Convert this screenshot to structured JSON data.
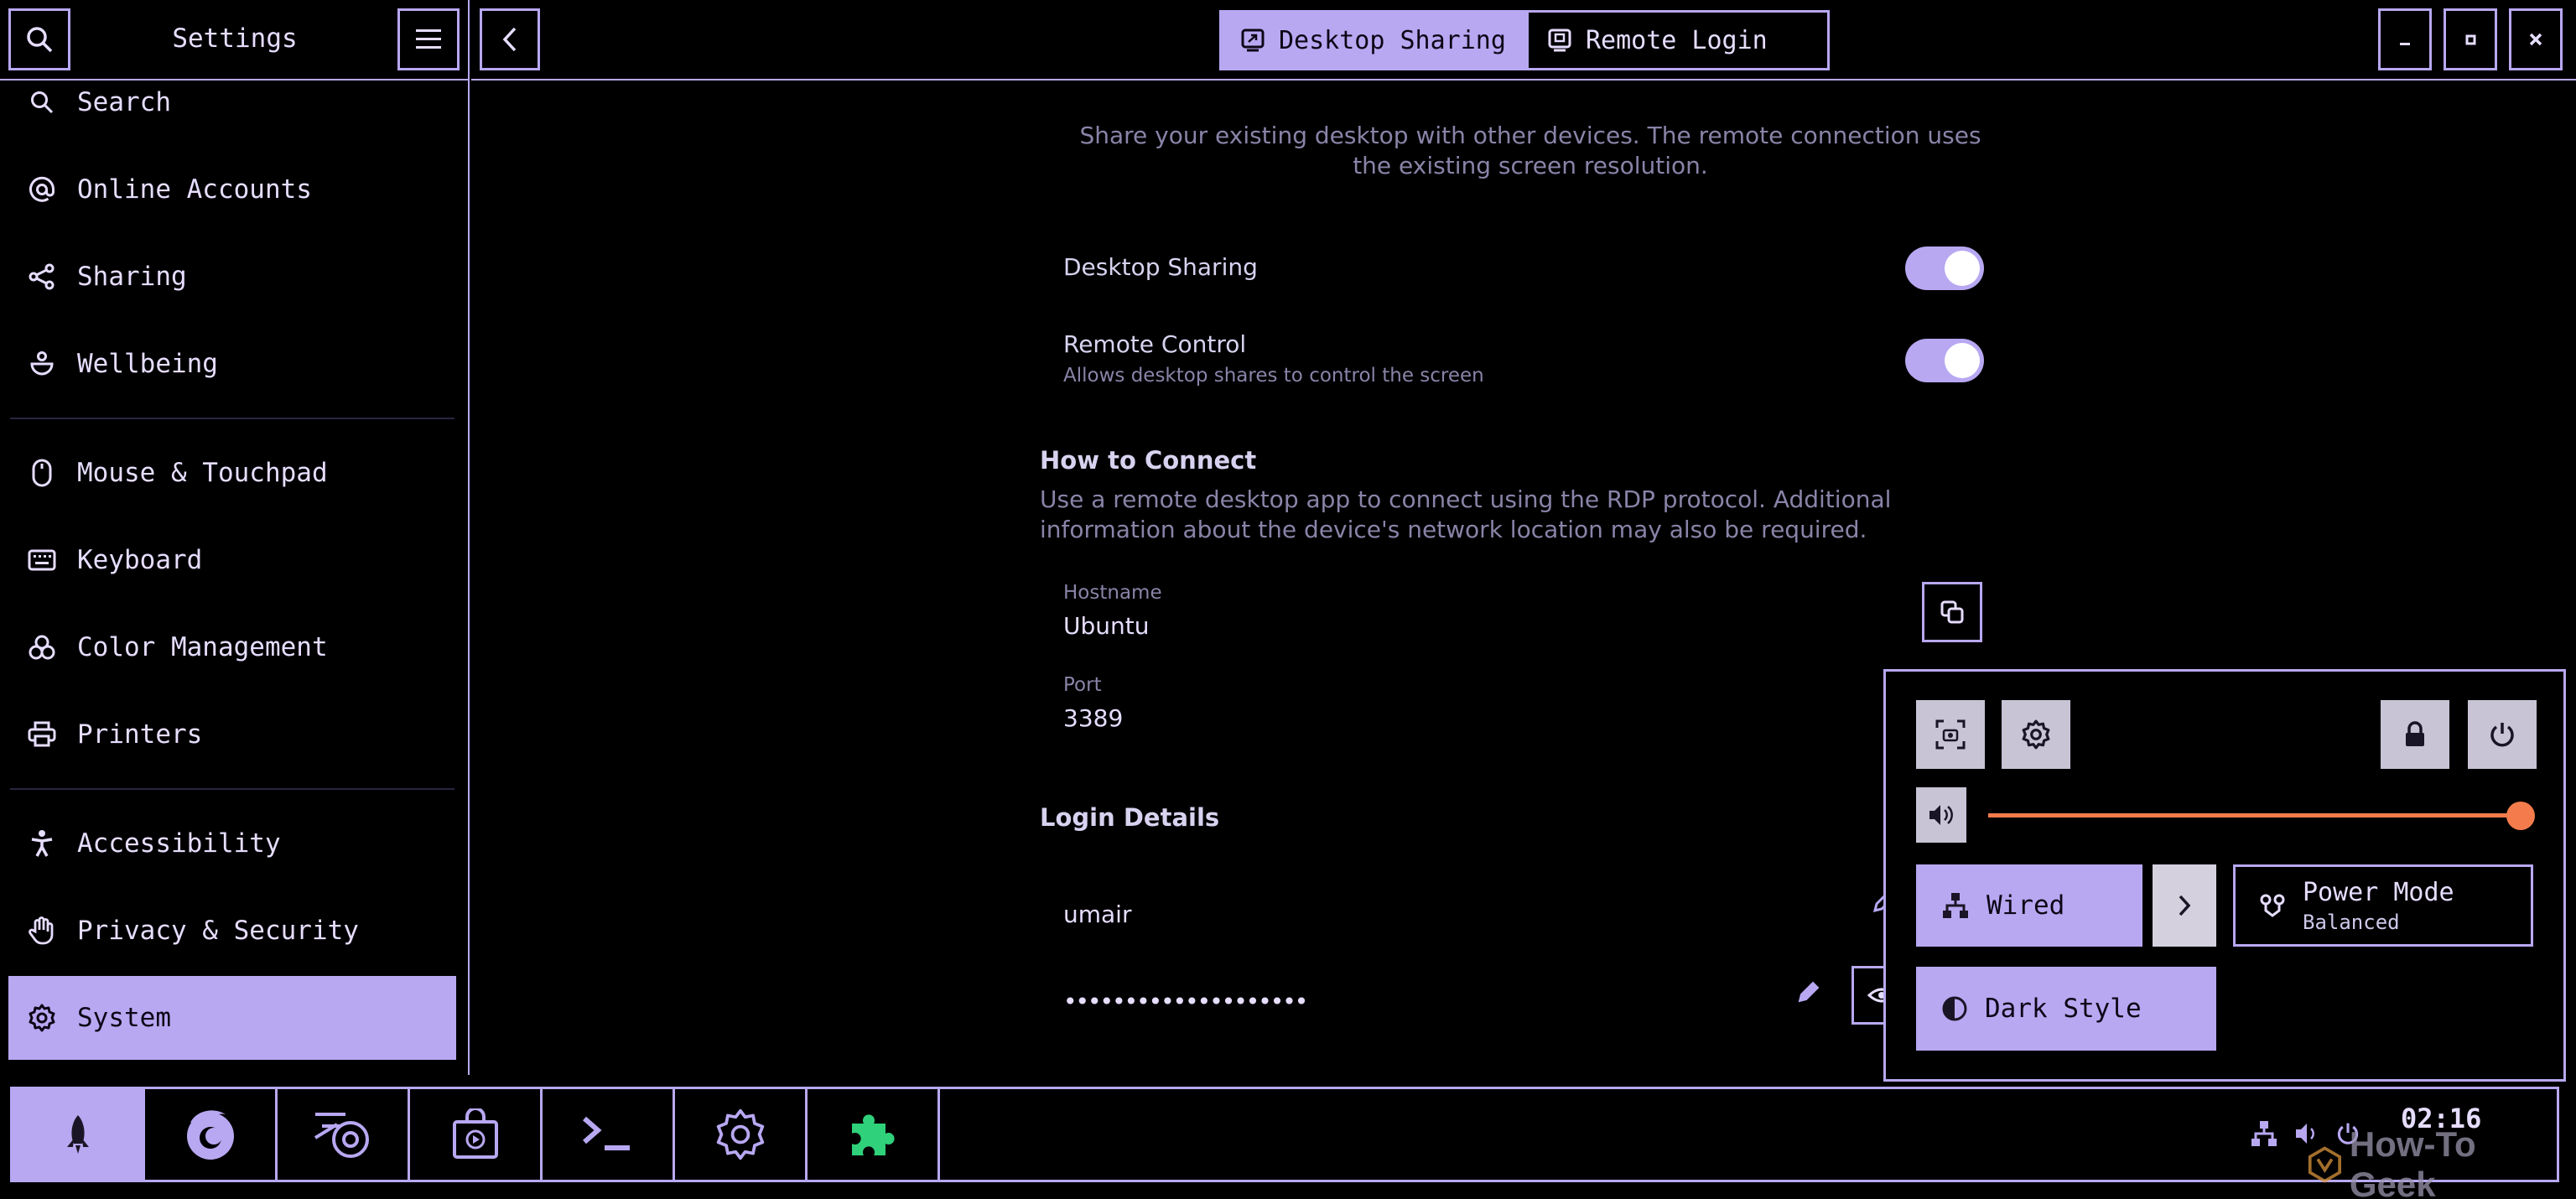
{
  "sidebar": {
    "title": "Settings",
    "items": [
      {
        "label": "Search",
        "icon": "search-icon"
      },
      {
        "label": "Online Accounts",
        "icon": "at-icon"
      },
      {
        "label": "Sharing",
        "icon": "share-icon"
      },
      {
        "label": "Wellbeing",
        "icon": "wellbeing-icon"
      },
      {
        "label": "Mouse & Touchpad",
        "icon": "mouse-icon"
      },
      {
        "label": "Keyboard",
        "icon": "keyboard-icon"
      },
      {
        "label": "Color Management",
        "icon": "color-icon"
      },
      {
        "label": "Printers",
        "icon": "printer-icon"
      },
      {
        "label": "Accessibility",
        "icon": "accessibility-icon"
      },
      {
        "label": "Privacy & Security",
        "icon": "hand-icon"
      },
      {
        "label": "System",
        "icon": "gear-icon"
      }
    ],
    "active": "System"
  },
  "header": {
    "tabs": [
      {
        "label": "Desktop Sharing",
        "icon": "desktop-share-icon",
        "active": true
      },
      {
        "label": "Remote Login",
        "icon": "remote-login-icon",
        "active": false
      }
    ]
  },
  "content": {
    "description": "Share your existing desktop with other devices. The remote connection uses the existing screen resolution.",
    "desktop_sharing": {
      "label": "Desktop Sharing",
      "enabled": true
    },
    "remote_control": {
      "label": "Remote Control",
      "subtitle": "Allows desktop shares to control the screen",
      "enabled": true
    },
    "how_to_connect": {
      "title": "How to Connect",
      "description": "Use a remote desktop app to connect using the RDP protocol. Additional information about the device's network location may also be required.",
      "hostname_label": "Hostname",
      "hostname_value": "Ubuntu",
      "port_label": "Port",
      "port_value": "3389"
    },
    "login_details": {
      "title": "Login Details",
      "username": "umair",
      "password": "••••••••••••••••••••"
    }
  },
  "quick_settings": {
    "volume_level": 1.0,
    "wired_label": "Wired",
    "power_mode_label": "Power Mode",
    "power_mode_value": "Balanced",
    "dark_style_label": "Dark Style",
    "colors": {
      "accent": "#b8a8f2",
      "slider": "#f47c4c"
    }
  },
  "taskbar": {
    "apps": [
      "launcher-icon",
      "firefox-icon",
      "blender-icon",
      "app-store-icon",
      "terminal-icon",
      "settings-icon",
      "extensions-icon"
    ],
    "clock": "02:16",
    "watermark": "How-To Geek"
  },
  "colors": {
    "accent": "#b8a8f2",
    "background": "#000000",
    "text": "#e6ddff"
  }
}
